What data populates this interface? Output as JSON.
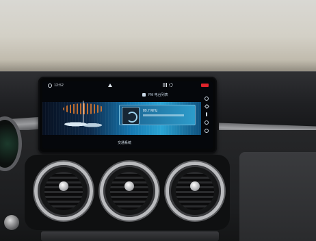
{
  "screen": {
    "status": {
      "time": "12:52"
    },
    "source": {
      "label": "FM 电台列表"
    },
    "station": {
      "frequency": "89.7 MHz"
    },
    "bottom_label": "交通系统"
  },
  "colors": {
    "accent": "#2aa4d4",
    "badge": "#e0242b",
    "dial": "#e07a2c"
  }
}
